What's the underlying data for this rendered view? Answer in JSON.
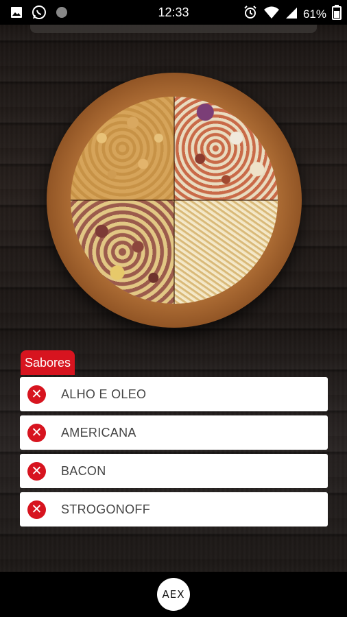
{
  "status_bar": {
    "time": "12:33",
    "battery": "61%",
    "icons_left": [
      "image-icon",
      "whatsapp-icon",
      "dot-icon"
    ],
    "icons_right": [
      "alarm-icon",
      "wifi-icon",
      "signal-icon",
      "battery-icon"
    ]
  },
  "pizza": {
    "quarters": [
      "ALHO E OLEO",
      "AMERICANA",
      "BACON",
      "STROGONOFF"
    ]
  },
  "flavors": {
    "tag": "Sabores",
    "items": [
      {
        "label": "ALHO E OLEO"
      },
      {
        "label": "AMERICANA"
      },
      {
        "label": "BACON"
      },
      {
        "label": "STROGONOFF"
      }
    ]
  },
  "bottom": {
    "logo_text": "AEX"
  },
  "colors": {
    "accent": "#d7141f",
    "background": "#1c1715"
  }
}
